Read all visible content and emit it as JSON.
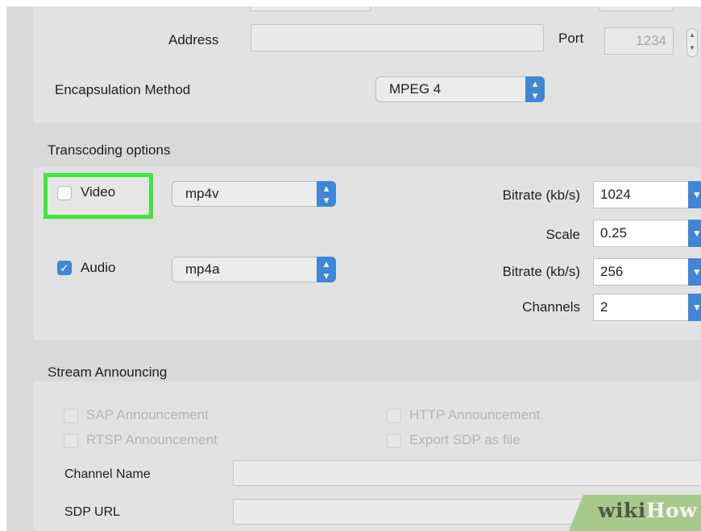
{
  "destination": {
    "address_label": "Address",
    "address_value": "",
    "port_label": "Port",
    "port_value": "1234",
    "encapsulation_label": "Encapsulation Method",
    "encapsulation_value": "MPEG 4"
  },
  "transcoding": {
    "section_title": "Transcoding options",
    "video": {
      "label": "Video",
      "checked": false,
      "codec": "mp4v",
      "bitrate_label": "Bitrate (kb/s)",
      "bitrate_value": "1024",
      "scale_label": "Scale",
      "scale_value": "0.25"
    },
    "audio": {
      "label": "Audio",
      "checked": true,
      "codec": "mp4a",
      "bitrate_label": "Bitrate (kb/s)",
      "bitrate_value": "256",
      "channels_label": "Channels",
      "channels_value": "2"
    }
  },
  "stream_announcing": {
    "section_title": "Stream Announcing",
    "sap_label": "SAP Announcement",
    "rtsp_label": "RTSP Announcement",
    "http_label": "HTTP Announcement",
    "sdp_file_label": "Export SDP as file",
    "channel_name_label": "Channel Name",
    "sdp_url_label": "SDP URL"
  },
  "watermark": {
    "wiki": "wiki",
    "how": "How"
  },
  "colors": {
    "accent_blue": "#3f86d6",
    "highlight_green": "#3ee63a",
    "panel_gray": "#e2e2e2"
  }
}
